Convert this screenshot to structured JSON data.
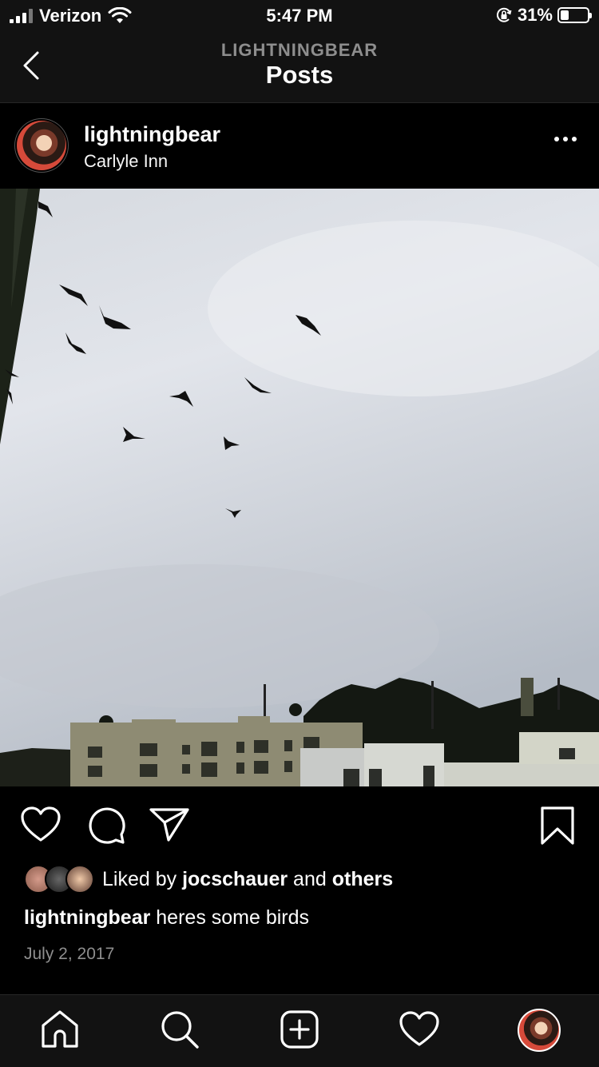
{
  "status_bar": {
    "carrier": "Verizon",
    "time": "5:47 PM",
    "battery_percent": "31%",
    "battery_level": 0.31
  },
  "nav": {
    "subtitle": "LIGHTNINGBEAR",
    "title": "Posts"
  },
  "post": {
    "username": "lightningbear",
    "location": "Carlyle Inn",
    "likes": {
      "prefix": "Liked by",
      "user": "jocschauer",
      "joiner": "and",
      "others": "others"
    },
    "caption": {
      "username": "lightningbear",
      "text": "heres some birds"
    },
    "date": "July 2, 2017"
  },
  "colors": {
    "background": "#000000",
    "bar": "#121212",
    "secondary_text": "#8e8e8e"
  },
  "icons": {
    "back": "chevron-left-icon",
    "more": "more-options-icon",
    "like": "heart-icon",
    "comment": "comment-icon",
    "share": "paper-plane-icon",
    "save": "bookmark-icon",
    "home": "home-icon",
    "search": "search-icon",
    "new_post": "plus-square-icon",
    "activity": "heart-icon",
    "profile": "profile-avatar"
  }
}
